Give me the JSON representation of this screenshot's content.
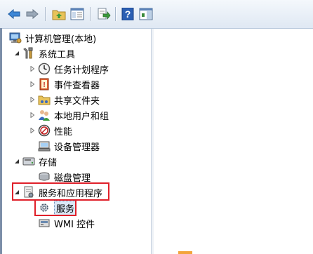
{
  "toolbar": {
    "buttons": [
      {
        "name": "back-button",
        "icon": "back-arrow-icon"
      },
      {
        "name": "forward-button",
        "icon": "forward-arrow-icon"
      },
      {
        "name": "up-button",
        "icon": "folder-up-icon"
      },
      {
        "name": "show-hide-tree-button",
        "icon": "console-tree-icon"
      },
      {
        "name": "export-list-button",
        "icon": "export-icon"
      },
      {
        "name": "help-button",
        "icon": "help-icon",
        "label": "?"
      },
      {
        "name": "action-pane-button",
        "icon": "action-pane-icon"
      }
    ]
  },
  "tree": {
    "root": "计算机管理(本地)",
    "system_tools": "系统工具",
    "task_scheduler": "任务计划程序",
    "event_viewer": "事件查看器",
    "shared_folders": "共享文件夹",
    "local_users": "本地用户和组",
    "performance": "性能",
    "device_manager": "设备管理器",
    "storage": "存储",
    "disk_management": "磁盘管理",
    "services_apps": "服务和应用程序",
    "services": "服务",
    "wmi": "WMI 控件"
  },
  "colors": {
    "highlight_box": "#e0202a",
    "toolbar_top": "#f4f8fc",
    "toolbar_bottom": "#dfe8f3",
    "selection": "#dbe8f7"
  }
}
